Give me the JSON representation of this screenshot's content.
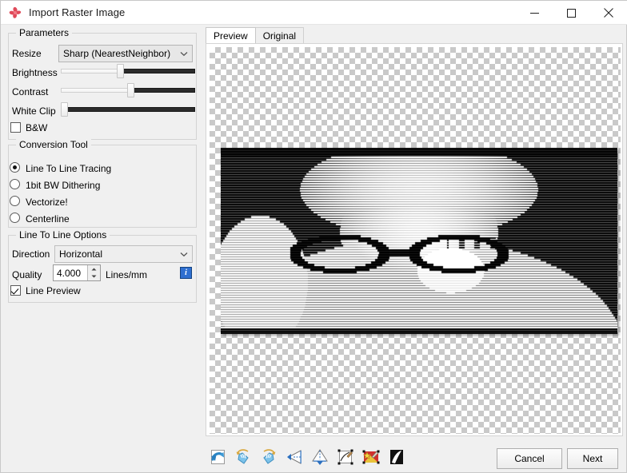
{
  "window": {
    "title": "Import Raster Image",
    "icon": "flower-icon",
    "minimize_label": "—",
    "maximize_label": "□",
    "close_label": "✕"
  },
  "parameters": {
    "group_title": "Parameters",
    "resize": {
      "label": "Resize",
      "value": "Sharp (NearestNeighbor)",
      "arrow": "⌄"
    },
    "brightness": {
      "label": "Brightness",
      "percent": 44
    },
    "contrast": {
      "label": "Contrast",
      "percent": 52
    },
    "white_clip": {
      "label": "White Clip",
      "percent": 1
    },
    "bw": {
      "label": "B&W",
      "checked": false
    }
  },
  "conversion_tool": {
    "group_title": "Conversion Tool",
    "options": [
      {
        "label": "Line To Line Tracing",
        "selected": true
      },
      {
        "label": "1bit BW Dithering",
        "selected": false
      },
      {
        "label": "Vectorize!",
        "selected": false
      },
      {
        "label": "Centerline",
        "selected": false
      }
    ]
  },
  "line_options": {
    "group_title": "Line To Line Options",
    "direction": {
      "label": "Direction",
      "value": "Horizontal",
      "arrow": "⌄"
    },
    "quality": {
      "label": "Quality",
      "value": "4.000",
      "unit": "Lines/mm",
      "up": "▲",
      "down": "▼"
    },
    "info": {
      "label": "i",
      "name": "info-icon",
      "color": "#2f6fd0"
    },
    "line_preview": {
      "label": "Line Preview",
      "checked": true
    }
  },
  "preview": {
    "tabs": [
      {
        "label": "Preview",
        "active": true
      },
      {
        "label": "Original",
        "active": false
      }
    ]
  },
  "toolbar": {
    "icons": [
      {
        "name": "reset-arrow-icon",
        "title": "Reset"
      },
      {
        "name": "rotate-left-icon",
        "title": "Rotate Left"
      },
      {
        "name": "rotate-right-icon",
        "title": "Rotate Right"
      },
      {
        "name": "flip-horizontal-icon",
        "title": "Flip Horizontal"
      },
      {
        "name": "flip-vertical-icon",
        "title": "Flip Vertical"
      },
      {
        "name": "edit-contour-icon",
        "title": "Edit"
      },
      {
        "name": "color-adjust-icon",
        "title": "Color"
      },
      {
        "name": "invert-icon",
        "title": "Invert"
      }
    ]
  },
  "actions": {
    "cancel_label": "Cancel",
    "next_label": "Next"
  }
}
